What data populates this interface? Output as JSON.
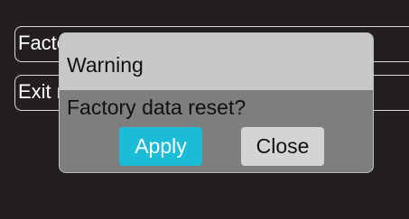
{
  "background_menu": {
    "items": [
      {
        "label": "Factory data reset"
      },
      {
        "label": "Exit menu"
      }
    ]
  },
  "dialog": {
    "title": "Warning",
    "message": "Factory data reset?",
    "apply_label": "Apply",
    "close_label": "Close"
  },
  "colors": {
    "background": "#231f20",
    "dialog_header": "#c8c8c8",
    "dialog_body": "#7e7e7e",
    "apply_button": "#1bbcd8",
    "close_button": "#d4d4d4"
  }
}
